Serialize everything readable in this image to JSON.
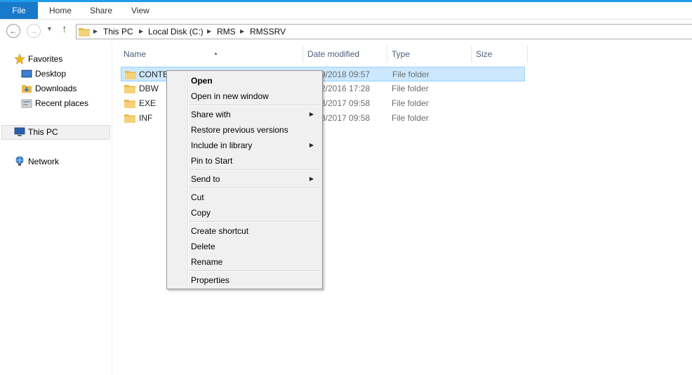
{
  "ribbon": {
    "tabs": [
      {
        "label": "File"
      },
      {
        "label": "Home"
      },
      {
        "label": "Share"
      },
      {
        "label": "View"
      }
    ]
  },
  "address": {
    "breadcrumb": [
      "This PC",
      "Local Disk (C:)",
      "RMS",
      "RMSSRV"
    ]
  },
  "navpane": {
    "items": [
      {
        "label": "Favorites",
        "icon": "star-icon"
      },
      {
        "label": "Desktop",
        "icon": "desktop-icon"
      },
      {
        "label": "Downloads",
        "icon": "downloads-icon"
      },
      {
        "label": "Recent places",
        "icon": "recent-places-icon"
      },
      {
        "label": "This PC",
        "icon": "computer-icon"
      },
      {
        "label": "Network",
        "icon": "network-icon"
      }
    ]
  },
  "filelist": {
    "columns": [
      "Name",
      "Date modified",
      "Type",
      "Size"
    ],
    "rows": [
      {
        "name": "CONTE",
        "date": "9/2018 09:57",
        "type": "File folder",
        "size": ""
      },
      {
        "name": "DBW",
        "date": "2/2016 17:28",
        "type": "File folder",
        "size": ""
      },
      {
        "name": "EXE",
        "date": "3/2017 09:58",
        "type": "File folder",
        "size": ""
      },
      {
        "name": "INF",
        "date": "3/2017 09:58",
        "type": "File folder",
        "size": ""
      }
    ]
  },
  "context_menu": {
    "items": [
      {
        "label": "Open",
        "bold": true
      },
      {
        "label": "Open in new window"
      },
      {
        "label": "Share with",
        "submenu": true
      },
      {
        "label": "Restore previous versions"
      },
      {
        "label": "Include in library",
        "submenu": true
      },
      {
        "label": "Pin to Start"
      },
      {
        "label": "Send to",
        "submenu": true
      },
      {
        "label": "Cut"
      },
      {
        "label": "Copy"
      },
      {
        "label": "Create shortcut"
      },
      {
        "label": "Delete"
      },
      {
        "label": "Rename"
      },
      {
        "label": "Properties"
      }
    ]
  },
  "colors": {
    "accent": "#1979ca",
    "selection_bg": "#cce8ff",
    "selection_border": "#99d1ff",
    "folder": "#e8b84a"
  }
}
